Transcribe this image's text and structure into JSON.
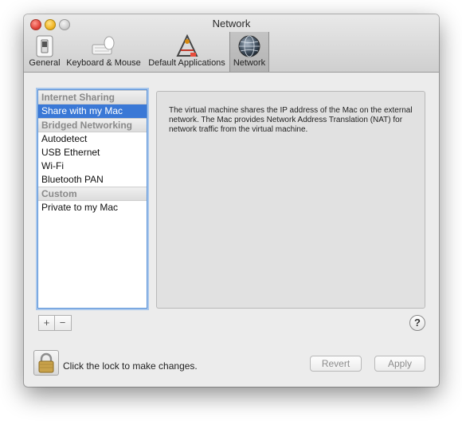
{
  "window": {
    "title": "Network"
  },
  "toolbar": {
    "items": [
      {
        "label": "General",
        "icon": "general-switch-icon",
        "selected": false
      },
      {
        "label": "Keyboard & Mouse",
        "icon": "keyboard-mouse-icon",
        "selected": false
      },
      {
        "label": "Default Applications",
        "icon": "default-applications-icon",
        "selected": false
      },
      {
        "label": "Network",
        "icon": "network-globe-icon",
        "selected": true
      }
    ]
  },
  "sidebar": {
    "groups": [
      {
        "header": "Internet Sharing",
        "items": [
          "Share with my Mac"
        ]
      },
      {
        "header": "Bridged Networking",
        "items": [
          "Autodetect",
          "USB Ethernet",
          "Wi-Fi",
          "Bluetooth PAN"
        ]
      },
      {
        "header": "Custom",
        "items": [
          "Private to my Mac"
        ]
      }
    ],
    "selected_item": "Share with my Mac",
    "add_label": "+",
    "remove_label": "−"
  },
  "description": {
    "text": "The virtual machine shares the IP address of the Mac on the external network. The Mac provides Network Address Translation (NAT) for network traffic from the virtual machine."
  },
  "help": {
    "label": "?"
  },
  "footer": {
    "lock_text": "Click the lock to make changes.",
    "revert_label": "Revert",
    "apply_label": "Apply"
  },
  "colors": {
    "selection": "#3a78d6",
    "focus_ring": "#5b93d8",
    "window_bg": "#ececec"
  }
}
